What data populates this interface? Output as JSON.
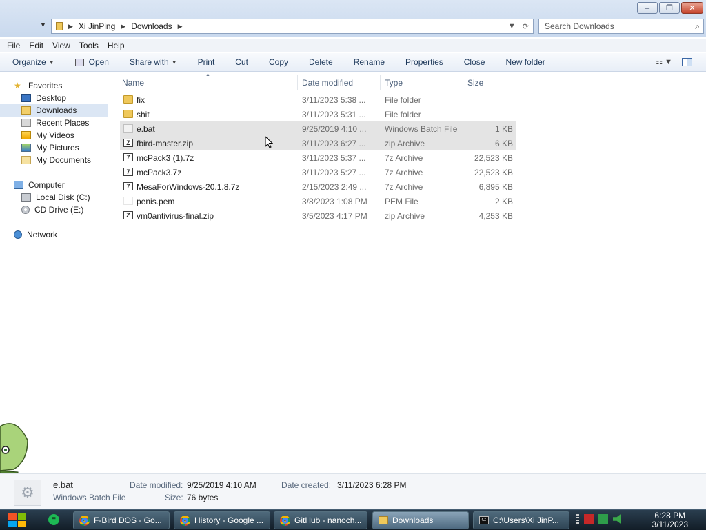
{
  "window": {
    "minimize_label": "–",
    "maximize_label": "❐",
    "close_label": "✕"
  },
  "address": {
    "segments": [
      "Xi JinPing",
      "Downloads"
    ],
    "search_placeholder": "Search Downloads"
  },
  "menu": {
    "items": [
      "File",
      "Edit",
      "View",
      "Tools",
      "Help"
    ]
  },
  "toolbar": {
    "organize": "Organize",
    "open": "Open",
    "share_with": "Share with",
    "print": "Print",
    "cut": "Cut",
    "copy": "Copy",
    "delete": "Delete",
    "rename": "Rename",
    "properties": "Properties",
    "close": "Close",
    "new_folder": "New folder"
  },
  "sidebar": {
    "favorites": {
      "label": "Favorites",
      "items": [
        "Desktop",
        "Downloads",
        "Recent Places",
        "My Videos",
        "My Pictures",
        "My Documents"
      ]
    },
    "computer": {
      "label": "Computer",
      "items": [
        "Local Disk (C:)",
        "CD Drive (E:)"
      ]
    },
    "network": {
      "label": "Network"
    }
  },
  "columns": {
    "name": "Name",
    "date_modified": "Date modified",
    "type": "Type",
    "size": "Size"
  },
  "files": [
    {
      "name": "fix",
      "date": "3/11/2023 5:38 ...",
      "type": "File folder",
      "size": ""
    },
    {
      "name": "shit",
      "date": "3/11/2023 5:31 ...",
      "type": "File folder",
      "size": ""
    },
    {
      "name": "e.bat",
      "date": "9/25/2019 4:10 ...",
      "type": "Windows Batch File",
      "size": "1 KB"
    },
    {
      "name": "fbird-master.zip",
      "date": "3/11/2023 6:27 ...",
      "type": "zip Archive",
      "size": "6 KB"
    },
    {
      "name": "mcPack3 (1).7z",
      "date": "3/11/2023 5:37 ...",
      "type": "7z Archive",
      "size": "22,523 KB"
    },
    {
      "name": "mcPack3.7z",
      "date": "3/11/2023 5:27 ...",
      "type": "7z Archive",
      "size": "22,523 KB"
    },
    {
      "name": "MesaForWindows-20.1.8.7z",
      "date": "2/15/2023 2:49 ...",
      "type": "7z Archive",
      "size": "6,895 KB"
    },
    {
      "name": "penis.pem",
      "date": "3/8/2023 1:08 PM",
      "type": "PEM File",
      "size": "2 KB"
    },
    {
      "name": "vm0antivirus-final.zip",
      "date": "3/5/2023 4:17 PM",
      "type": "zip Archive",
      "size": "4,253 KB"
    }
  ],
  "details": {
    "name": "e.bat",
    "type": "Windows Batch File",
    "date_modified_label": "Date modified:",
    "date_modified": "9/25/2019 4:10 AM",
    "date_created_label": "Date created:",
    "date_created": "3/11/2023 6:28 PM",
    "size_label": "Size:",
    "size": "76 bytes"
  },
  "taskbar": {
    "tasks": [
      "F-Bird DOS - Go...",
      "History - Google ...",
      "GitHub - nanoch...",
      "Downloads",
      "C:\\Users\\Xi JinP..."
    ],
    "time": "6:28 PM",
    "date": "3/11/2023"
  }
}
